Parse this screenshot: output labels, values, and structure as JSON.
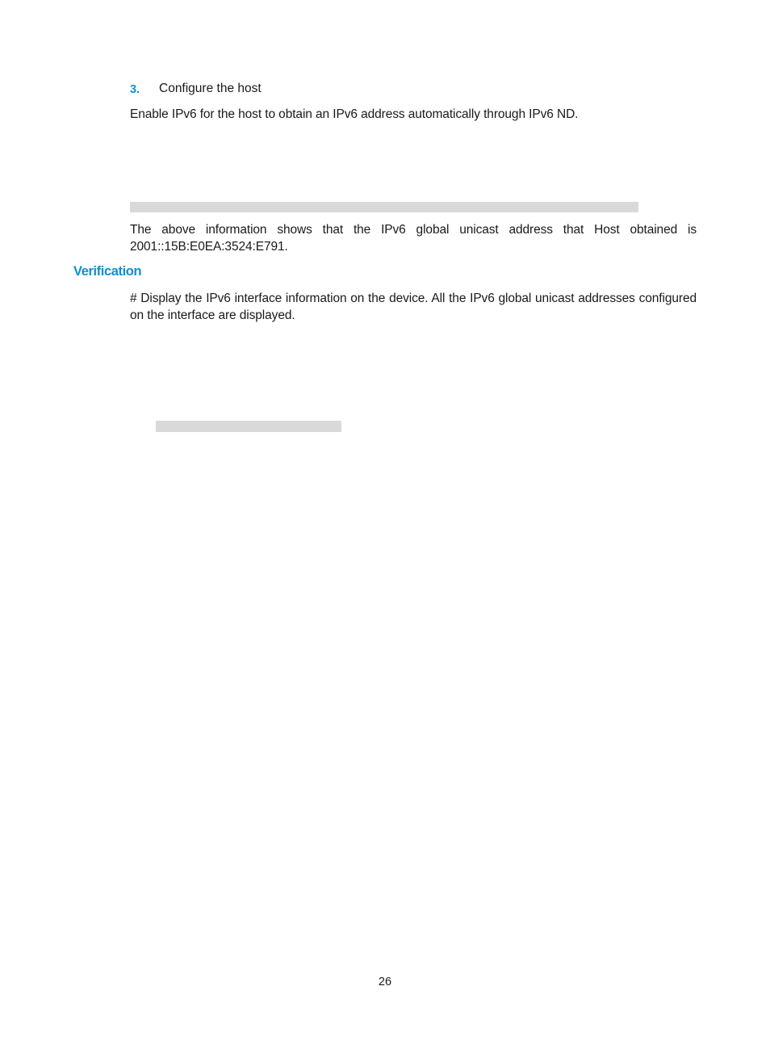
{
  "step": {
    "number": "3.",
    "label": "Configure the host"
  },
  "paragraphs": {
    "enable_ipv6": "Enable IPv6 for the host to obtain an IPv6 address automatically through IPv6 ND.",
    "above_info_line1": "The above information shows that the IPv6 global unicast address that Host obtained is",
    "above_info_line2": "2001::15B:E0EA:3524:E791.",
    "display_info": "# Display the IPv6 interface information on the device. All the IPv6 global unicast addresses configured on the interface are displayed."
  },
  "section": {
    "heading": "Verification"
  },
  "footer": {
    "page_number": "26"
  }
}
